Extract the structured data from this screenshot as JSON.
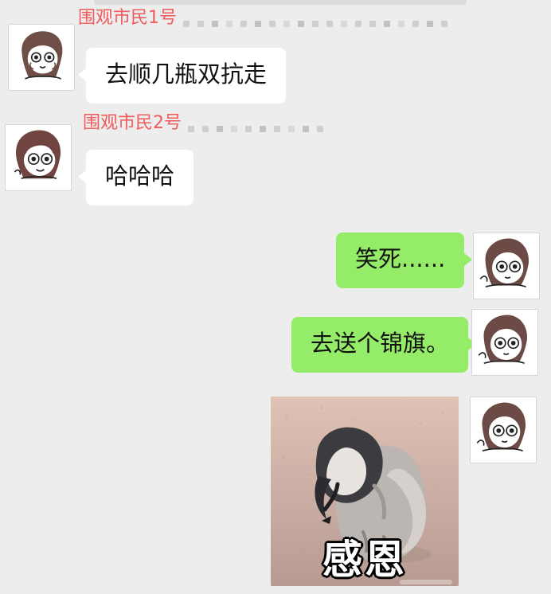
{
  "chat": {
    "messages": [
      {
        "sender": "围观市民1号",
        "text": "去顺几瓶双抗走",
        "avatar_icon": "sketch-girl-avatar"
      },
      {
        "sender": "围观市民2号",
        "text": "哈哈哈",
        "avatar_icon": "sketch-girl-avatar"
      },
      {
        "sender": "",
        "text": "笑死......",
        "avatar_icon": "sketch-girl-avatar"
      },
      {
        "sender": "",
        "text": "去送个锦旗。",
        "avatar_icon": "sketch-girl-avatar"
      },
      {
        "sender": "",
        "text": "",
        "meme_caption": "感恩",
        "image_icon": "penguin-meme-image",
        "avatar_icon": "sketch-girl-avatar"
      }
    ]
  },
  "colors": {
    "background": "#ededed",
    "incoming_bubble": "#ffffff",
    "outgoing_bubble": "#95ec69",
    "sender_name": "#f15b5b"
  }
}
